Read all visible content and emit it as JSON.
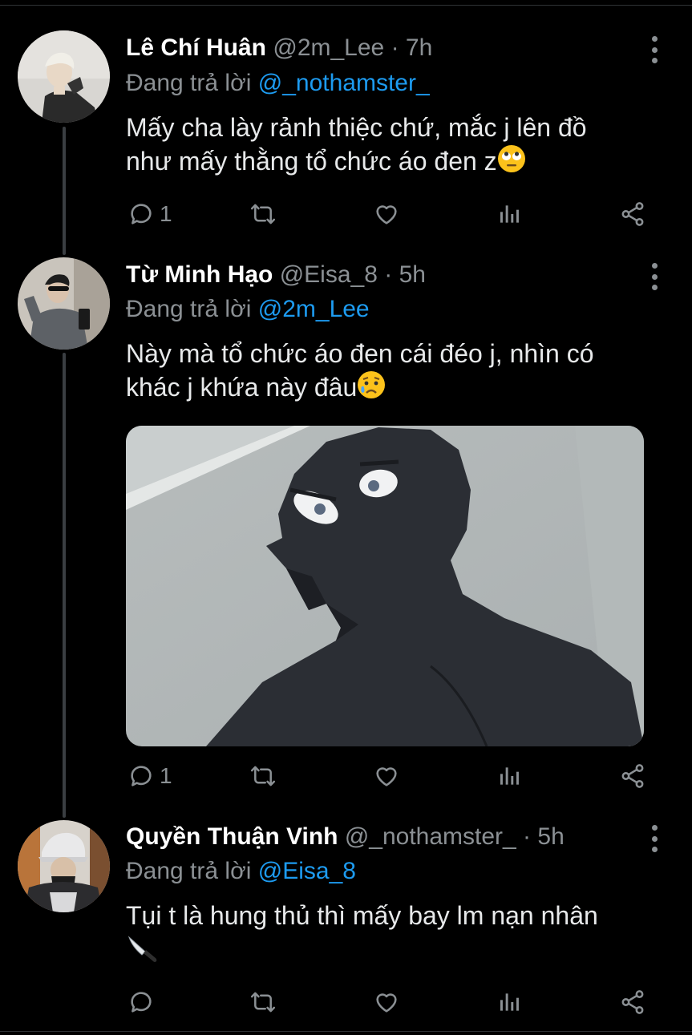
{
  "tweets": [
    {
      "name": "Lê Chí Huân",
      "handle": "@2m_Lee",
      "dot": " · ",
      "time": "7h",
      "reply_prefix": "Đang trả lời ",
      "reply_to": "@_nothamster_",
      "text_line1": "Mấy cha lày rảnh thiệc chứ, mắc j lên đồ",
      "text_line2": "như mấy thằng tổ chức áo đen z",
      "emoji": "face-with-rolling-eyes",
      "reply_count": "1",
      "retweet_count": "",
      "like_count": ""
    },
    {
      "name": "Từ Minh Hạo",
      "handle": "@Eisa_8",
      "dot": " · ",
      "time": "5h",
      "reply_prefix": "Đang trả lời ",
      "reply_to": "@2m_Lee",
      "text_line1": "Này mà tổ chức áo đen cái đéo j, nhìn có",
      "text_line2": "khác j khứa này đâu",
      "emoji": "sad-but-relieved-face",
      "media": "anime-shadow-figure-image",
      "reply_count": "1",
      "retweet_count": "",
      "like_count": ""
    },
    {
      "name": "Quyền Thuận Vinh",
      "handle": "@_nothamster_",
      "dot": " · ",
      "time": "5h",
      "reply_prefix": "Đang trả lời ",
      "reply_to": "@Eisa_8",
      "text_line1": "Tụi t là hung thủ thì mấy bay lm nạn nhân",
      "text_line2": "",
      "emoji": "kitchen-knife",
      "reply_count": "",
      "retweet_count": "",
      "like_count": ""
    }
  ],
  "colors": {
    "background": "#000000",
    "text": "#e7e9ea",
    "secondary": "#8b9094",
    "mention": "#1d9bf0",
    "thread_line": "#3a3e42"
  },
  "icons": [
    "reply-icon",
    "retweet-icon",
    "like-icon",
    "analytics-icon",
    "share-icon",
    "more-options-icon"
  ]
}
